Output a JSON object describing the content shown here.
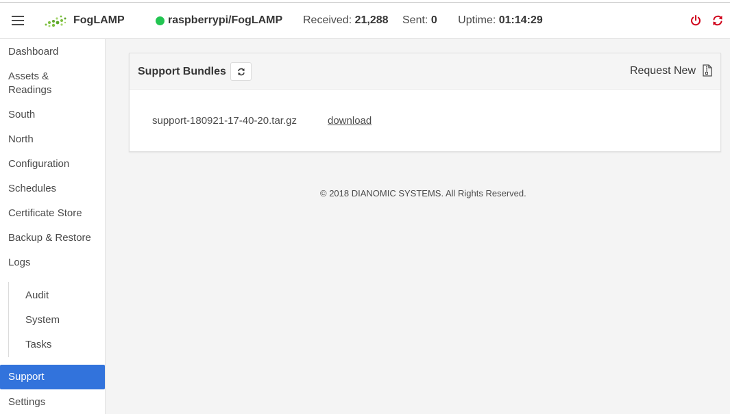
{
  "navbar": {
    "brand": "FogLAMP",
    "host": "raspberrypi/FogLAMP",
    "received_label": "Received:",
    "received_value": "21,288",
    "sent_label": "Sent:",
    "sent_value": "0",
    "uptime_label": "Uptime:",
    "uptime_value": "01:14:29",
    "status_color": "#23c552",
    "icons": [
      "menu-icon",
      "power-icon",
      "restart-icon"
    ]
  },
  "sidebar": {
    "items": [
      {
        "label": "Dashboard"
      },
      {
        "label": "Assets &\nReadings"
      },
      {
        "label": "South"
      },
      {
        "label": "North"
      },
      {
        "label": "Configuration"
      },
      {
        "label": "Schedules"
      },
      {
        "label": "Certificate Store"
      },
      {
        "label": "Backup & Restore"
      },
      {
        "label": "Logs"
      },
      {
        "label": "Audit"
      },
      {
        "label": "System"
      },
      {
        "label": "Tasks"
      },
      {
        "label": "Support"
      },
      {
        "label": "Settings"
      }
    ],
    "active": "Support",
    "active_color": "#3273dc"
  },
  "support": {
    "title": "Support Bundles",
    "request_new": "Request New",
    "bundles": [
      {
        "name": "support-180921-17-40-20.tar.gz",
        "action": "download"
      }
    ]
  },
  "footer": {
    "text": "© 2018 DIANOMIC SYSTEMS. All Rights Reserved."
  }
}
